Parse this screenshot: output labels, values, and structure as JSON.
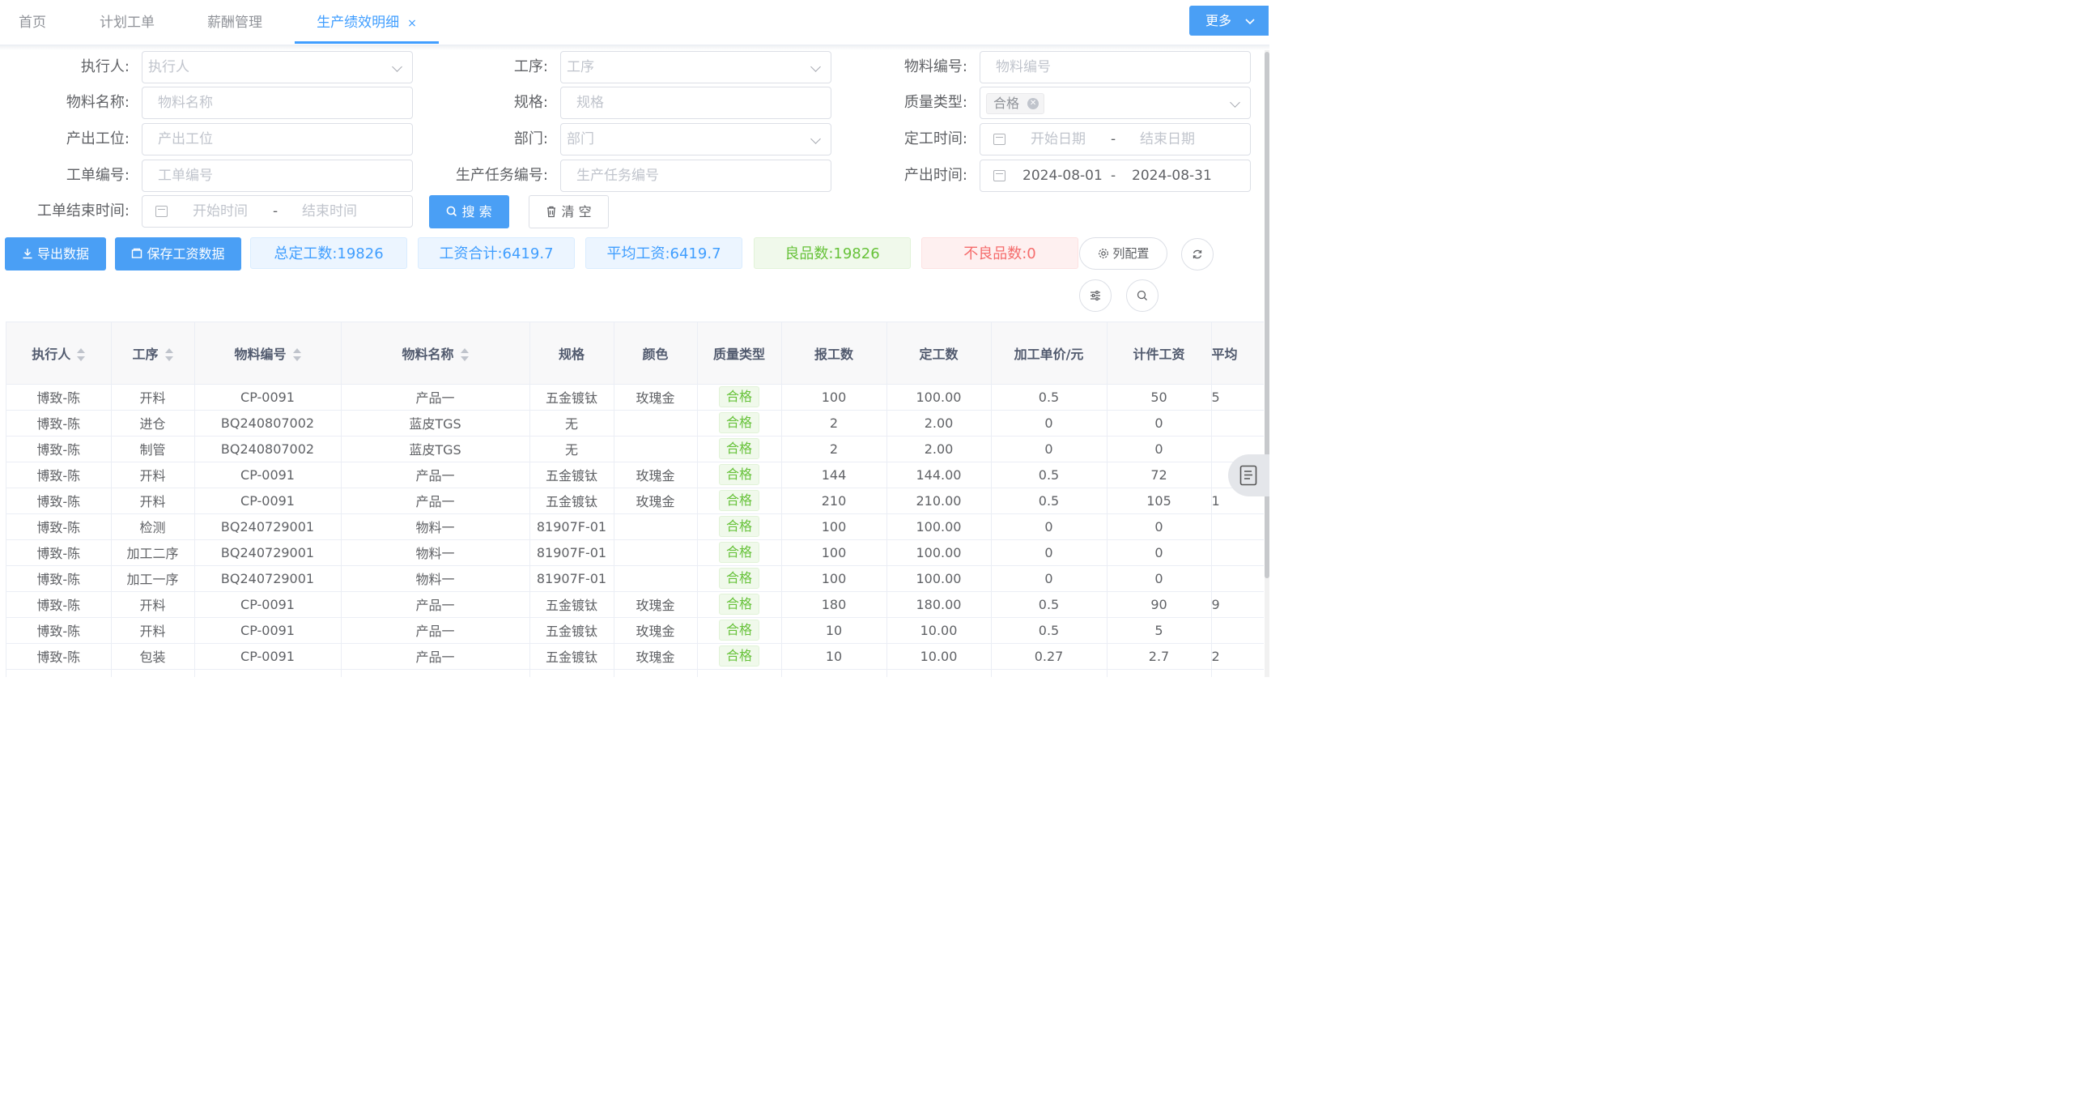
{
  "tabs": [
    {
      "label": "首页"
    },
    {
      "label": "计划工单"
    },
    {
      "label": "薪酬管理"
    },
    {
      "label": "生产绩效明细",
      "close": "×"
    }
  ],
  "more_button": {
    "label": "更多",
    "icon": "chevron-down-icon"
  },
  "filters": {
    "executor": {
      "label": "执行人:",
      "placeholder": "执行人"
    },
    "process": {
      "label": "工序:",
      "placeholder": "工序"
    },
    "material_code": {
      "label": "物料编号:",
      "placeholder": "物料编号"
    },
    "material_name": {
      "label": "物料名称:",
      "placeholder": "物料名称"
    },
    "spec": {
      "label": "规格:",
      "placeholder": "规格"
    },
    "quality_type": {
      "label": "质量类型:",
      "selected_tag": "合格"
    },
    "output_station": {
      "label": "产出工位:",
      "placeholder": "产出工位"
    },
    "department": {
      "label": "部门:",
      "placeholder": "部门"
    },
    "fixed_time": {
      "label": "定工时间:",
      "start_placeholder": "开始日期",
      "separator": "-",
      "end_placeholder": "结束日期"
    },
    "order_no": {
      "label": "工单编号:",
      "placeholder": "工单编号"
    },
    "task_no": {
      "label": "生产任务编号:",
      "placeholder": "生产任务编号"
    },
    "output_time": {
      "label": "产出时间:",
      "start": "2024-08-01",
      "separator": "-",
      "end": "2024-08-31"
    },
    "order_end_time": {
      "label": "工单结束时间:",
      "start_placeholder": "开始时间",
      "separator": "-",
      "end_placeholder": "结束时间"
    }
  },
  "buttons": {
    "search": "搜 索",
    "clear": "清 空",
    "export": "导出数据",
    "save_wage": "保存工资数据",
    "column_config": "列配置"
  },
  "stats": {
    "total_fixed": "总定工数:19826",
    "wage_total": "工资合计:6419.7",
    "avg_wage": "平均工资:6419.7",
    "good": "良品数:19826",
    "defect": "不良品数:0"
  },
  "colors": {
    "primary": "#4a9ff5",
    "success": "#67c23a",
    "danger": "#f56c6c"
  },
  "table": {
    "headers": [
      "执行人",
      "工序",
      "物料编号",
      "物料名称",
      "规格",
      "颜色",
      "质量类型",
      "报工数",
      "定工数",
      "加工单价/元",
      "计件工资",
      "平均"
    ],
    "rows": [
      [
        "博致-陈",
        "开料",
        "CP-0091",
        "产品一",
        "五金镀钛",
        "玫瑰金",
        "合格",
        "100",
        "100.00",
        "0.5",
        "50",
        "5"
      ],
      [
        "博致-陈",
        "进仓",
        "BQ240807002",
        "蓝皮TGS",
        "无",
        "",
        "合格",
        "2",
        "2.00",
        "0",
        "0",
        ""
      ],
      [
        "博致-陈",
        "制管",
        "BQ240807002",
        "蓝皮TGS",
        "无",
        "",
        "合格",
        "2",
        "2.00",
        "0",
        "0",
        ""
      ],
      [
        "博致-陈",
        "开料",
        "CP-0091",
        "产品一",
        "五金镀钛",
        "玫瑰金",
        "合格",
        "144",
        "144.00",
        "0.5",
        "72",
        ""
      ],
      [
        "博致-陈",
        "开料",
        "CP-0091",
        "产品一",
        "五金镀钛",
        "玫瑰金",
        "合格",
        "210",
        "210.00",
        "0.5",
        "105",
        "1"
      ],
      [
        "博致-陈",
        "检测",
        "BQ240729001",
        "物料一",
        "81907F-01",
        "",
        "合格",
        "100",
        "100.00",
        "0",
        "0",
        ""
      ],
      [
        "博致-陈",
        "加工二序",
        "BQ240729001",
        "物料一",
        "81907F-01",
        "",
        "合格",
        "100",
        "100.00",
        "0",
        "0",
        ""
      ],
      [
        "博致-陈",
        "加工一序",
        "BQ240729001",
        "物料一",
        "81907F-01",
        "",
        "合格",
        "100",
        "100.00",
        "0",
        "0",
        ""
      ],
      [
        "博致-陈",
        "开料",
        "CP-0091",
        "产品一",
        "五金镀钛",
        "玫瑰金",
        "合格",
        "180",
        "180.00",
        "0.5",
        "90",
        "9"
      ],
      [
        "博致-陈",
        "开料",
        "CP-0091",
        "产品一",
        "五金镀钛",
        "玫瑰金",
        "合格",
        "10",
        "10.00",
        "0.5",
        "5",
        ""
      ],
      [
        "博致-陈",
        "包装",
        "CP-0091",
        "产品一",
        "五金镀钛",
        "玫瑰金",
        "合格",
        "10",
        "10.00",
        "0.27",
        "2.7",
        "2"
      ],
      [
        "",
        "",
        "",
        "",
        "",
        "",
        "",
        "",
        "",
        "",
        "",
        ""
      ]
    ]
  }
}
